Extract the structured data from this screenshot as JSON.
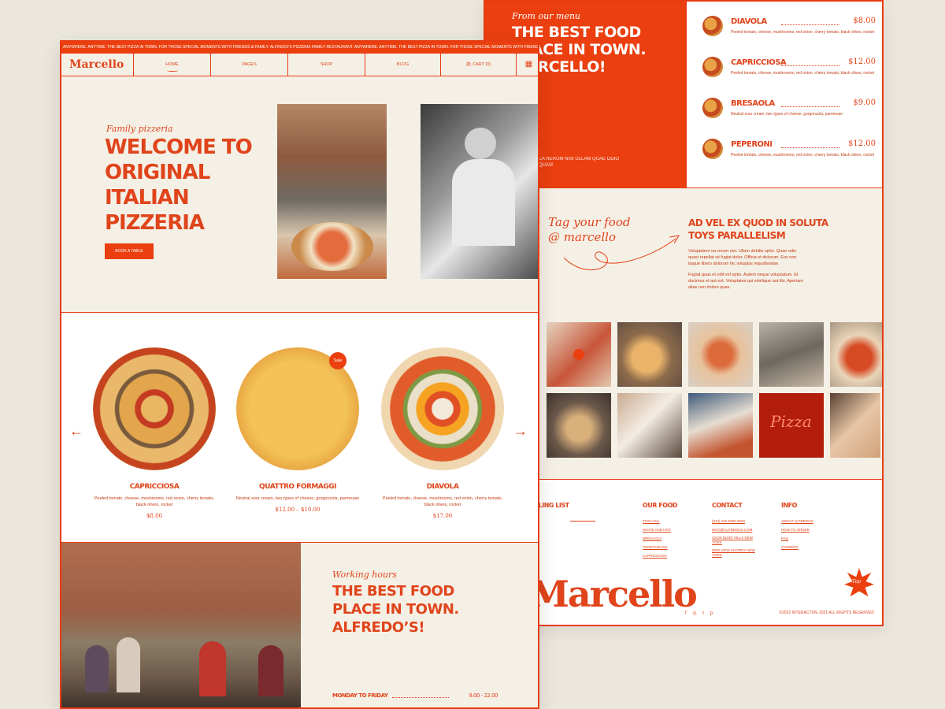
{
  "back": {
    "menu_label": "From our menu",
    "menu_title": "THE BEST FOOD PLACE IN TOWN. MARCELLO!",
    "menu_text": "EA RERUM NISI ULLAM QUAE ODIO QUAS!",
    "menu_items": [
      {
        "name": "DIAVOLA",
        "price": "$8.00",
        "desc": "Peeled tomato, cheese, mushrooms, red onion, cherry tomato, black olives, rocket"
      },
      {
        "name": "CAPRICCIOSA",
        "price": "$12.00",
        "desc": "Peeled tomato, cheese, mushrooms, red onion, cherry tomato, black olives, rocket"
      },
      {
        "name": "BRESAOLA",
        "price": "$9.00",
        "desc": "Neutral sour cream, two types of cheese, gorgonzola, parmesan"
      },
      {
        "name": "PEPERONI",
        "price": "$12.00",
        "desc": "Peeled tomato, cheese, mushrooms, red onion, cherry tomato, black olives, rocket"
      }
    ],
    "tag_title_1": "Tag your food",
    "tag_title_2": "@ marcello",
    "tag_heading": "AD VEL EX QUOD IN SOLUTA TOYS PARALLELISM",
    "tag_p1": "Voluptatem ea rerum nisi. Ullam debitis optio. Quae odio quasi repellat sit fugiat dolor. Officia et dolorum. Eos non itaque libero dolorum hic voluptas repudiandae.",
    "tag_p2": "Fugiat quas et odit vel optio. Autem neque voluptatum. Et ducimus et aut est. Voluptates qui similique aut illo. Aperiam alias non dolore quas.",
    "footer": {
      "mailing": "MAILING LIST",
      "col1_title": "OUR FOOD",
      "col1_links": [
        "TOSCANA",
        "WHITE AND HOT",
        "BRESAOLA",
        "VEGETARIANA",
        "CAPRICCIOSA"
      ],
      "col2_title": "CONTACT",
      "col2_links": [
        "(843) 462-5850 8500",
        "INFO@ALFREDOS.COM",
        "42425 ELMO HILLS NEW YORK",
        "5500 VIEW SHORES NEW YORK"
      ],
      "col3_title": "INFO",
      "col3_links": [
        "ABOUT ALFREDOS",
        "HOW TO ORDER",
        "FAQ",
        "CAREERS"
      ],
      "logo": "Marcello",
      "badge": "Top",
      "social": "f ◎ t p",
      "copyright": "©2022 INTERACTIVE 2021 ALL RIGHTS RESERVED"
    }
  },
  "front": {
    "ticker": "ANYWHERE. ANYTIME. THE BEST PIZZA IN TOWN. FOR THOSE SPECIAL MOMENTS WITH FRIENDS & FAMILY. ALFREDO'S PIZZERIA FAMILY RESTAURANT. ANYWHERE. ANYTIME. THE BEST PIZZA IN TOWN. FOR THOSE SPECIAL MOMENTS WITH FRIENDS & FAMILY.",
    "logo": "Marcello",
    "nav": [
      "HOME",
      "PAGES",
      "SHOP",
      "BLOG",
      "CART (0)"
    ],
    "hero_label": "Family pizzeria",
    "hero_title": "WELCOME TO ORIGINAL ITALIAN PIZZERIA",
    "hero_button": "BOOK A TABLE",
    "sale_badge": "Sale",
    "pizzas": [
      {
        "name": "CAPRICCIOSA",
        "desc": "Peeled tomato, cheese, mushrooms, red onion, cherry tomato, black olives, rocket",
        "price": "$8.00"
      },
      {
        "name": "QUATTRO FORMAGGI",
        "desc": "Neutral sour cream, two types of cheese, gorgonzola, parmesan",
        "price": "$12.00 – $10.00"
      },
      {
        "name": "DIAVOLA",
        "desc": "Peeled tomato, cheese, mushrooms, red onion, cherry tomato, black olives, rocket",
        "price": "$17.00"
      }
    ],
    "arrow_prev": "←",
    "arrow_next": "→",
    "hours_label": "Working hours",
    "hours_title": "THE BEST FOOD PLACE IN TOWN. ALFREDO’S!",
    "hours_day": "MONDAY TO FRIDAY",
    "hours_time": "9.00 - 22.00"
  }
}
